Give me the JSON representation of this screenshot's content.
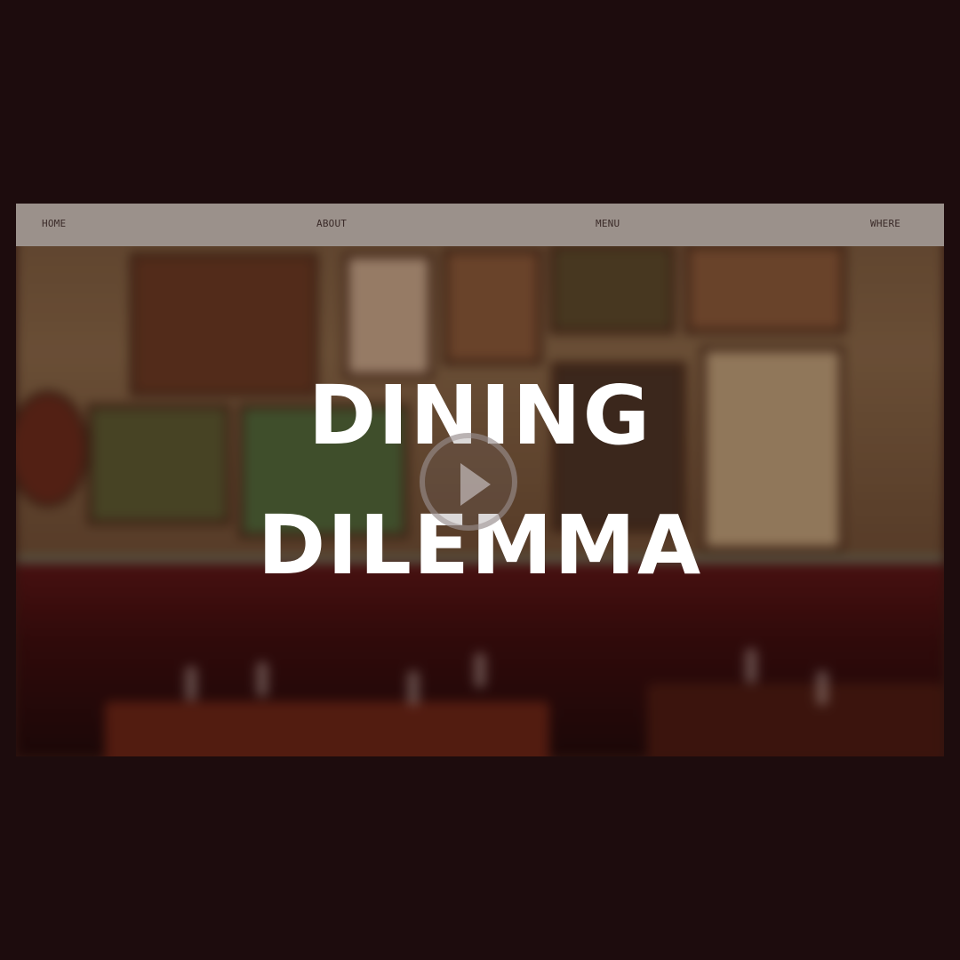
{
  "nav": {
    "items": [
      {
        "label": "HOME"
      },
      {
        "label": "ABOUT"
      },
      {
        "label": "MENU"
      },
      {
        "label": "WHERE"
      }
    ]
  },
  "hero": {
    "title_line_1": "DINING",
    "title_line_2": "DILEMMA",
    "play_icon": "play-icon"
  },
  "colors": {
    "page_background": "#1d0c0d",
    "nav_background": "#9b918b",
    "nav_text": "#3a2a28",
    "title_text": "#ffffff"
  }
}
